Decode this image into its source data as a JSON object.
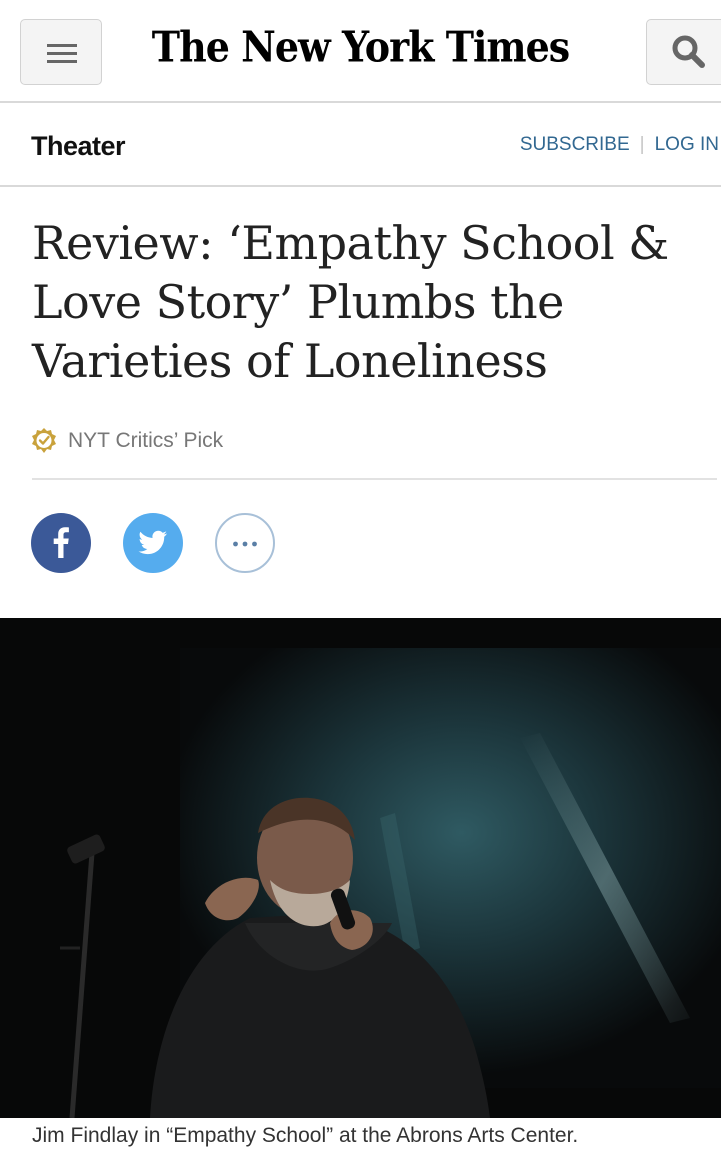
{
  "header": {
    "logo_text": "The New York Times",
    "menu_icon": "hamburger-icon",
    "search_icon": "search-icon"
  },
  "section": {
    "name": "Theater",
    "subscribe_label": "SUBSCRIBE",
    "login_label": "LOG IN",
    "separator": "|"
  },
  "article": {
    "headline": "Review: ‘Empathy School & Love Story’ Plumbs the Varieties of Loneliness",
    "critics_pick_label": "NYT Critics’ Pick",
    "caption": "Jim Findlay in “Empathy School” at the Abrons Arts Center."
  },
  "share": {
    "facebook_icon": "facebook-icon",
    "twitter_icon": "twitter-icon",
    "more_icon": "more-icon"
  },
  "colors": {
    "link": "#326891",
    "facebook": "#3b5998",
    "twitter": "#55acee",
    "critics_pick_badge": "#c9a23c"
  }
}
